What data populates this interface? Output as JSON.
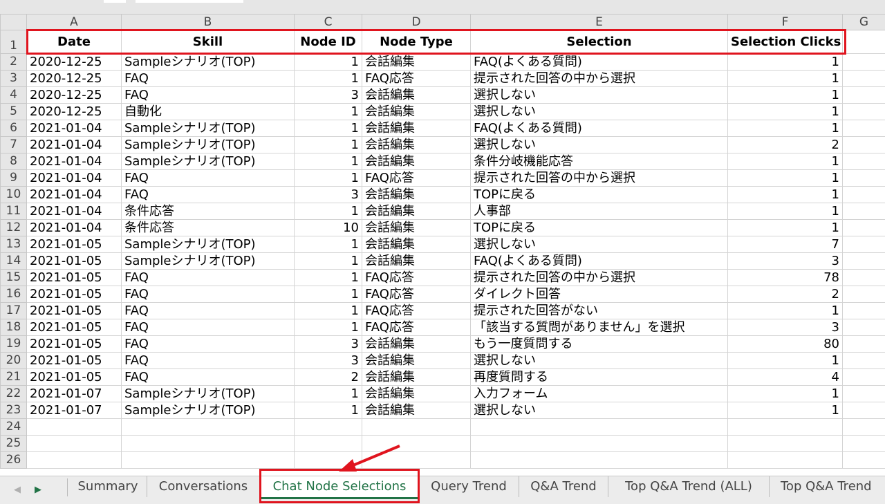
{
  "columns": [
    "A",
    "B",
    "C",
    "D",
    "E",
    "F",
    "G"
  ],
  "header": {
    "date": "Date",
    "skill": "Skill",
    "node_id": "Node ID",
    "node_type": "Node Type",
    "selection": "Selection",
    "selection_clicks": "Selection Clicks"
  },
  "rows": [
    [
      "2020-12-25",
      "Sampleシナリオ(TOP)",
      "1",
      "会話編集",
      "FAQ(よくある質問)",
      "1"
    ],
    [
      "2020-12-25",
      "FAQ",
      "1",
      "FAQ応答",
      "提示された回答の中から選択",
      "1"
    ],
    [
      "2020-12-25",
      "FAQ",
      "3",
      "会話編集",
      "選択しない",
      "1"
    ],
    [
      "2020-12-25",
      "自動化",
      "1",
      "会話編集",
      "選択しない",
      "1"
    ],
    [
      "2021-01-04",
      "Sampleシナリオ(TOP)",
      "1",
      "会話編集",
      "FAQ(よくある質問)",
      "1"
    ],
    [
      "2021-01-04",
      "Sampleシナリオ(TOP)",
      "1",
      "会話編集",
      "選択しない",
      "2"
    ],
    [
      "2021-01-04",
      "Sampleシナリオ(TOP)",
      "1",
      "会話編集",
      "条件分岐機能応答",
      "1"
    ],
    [
      "2021-01-04",
      "FAQ",
      "1",
      "FAQ応答",
      "提示された回答の中から選択",
      "1"
    ],
    [
      "2021-01-04",
      "FAQ",
      "3",
      "会話編集",
      "TOPに戻る",
      "1"
    ],
    [
      "2021-01-04",
      "条件応答",
      "1",
      "会話編集",
      "人事部",
      "1"
    ],
    [
      "2021-01-04",
      "条件応答",
      "10",
      "会話編集",
      "TOPに戻る",
      "1"
    ],
    [
      "2021-01-05",
      "Sampleシナリオ(TOP)",
      "1",
      "会話編集",
      "選択しない",
      "7"
    ],
    [
      "2021-01-05",
      "Sampleシナリオ(TOP)",
      "1",
      "会話編集",
      "FAQ(よくある質問)",
      "3"
    ],
    [
      "2021-01-05",
      "FAQ",
      "1",
      "FAQ応答",
      "提示された回答の中から選択",
      "78"
    ],
    [
      "2021-01-05",
      "FAQ",
      "1",
      "FAQ応答",
      "ダイレクト回答",
      "2"
    ],
    [
      "2021-01-05",
      "FAQ",
      "1",
      "FAQ応答",
      "提示された回答がない",
      "1"
    ],
    [
      "2021-01-05",
      "FAQ",
      "1",
      "FAQ応答",
      "「該当する質問がありません」を選択",
      "3"
    ],
    [
      "2021-01-05",
      "FAQ",
      "3",
      "会話編集",
      "もう一度質問する",
      "80"
    ],
    [
      "2021-01-05",
      "FAQ",
      "3",
      "会話編集",
      "選択しない",
      "1"
    ],
    [
      "2021-01-05",
      "FAQ",
      "2",
      "会話編集",
      "再度質問する",
      "4"
    ],
    [
      "2021-01-07",
      "Sampleシナリオ(TOP)",
      "1",
      "会話編集",
      "入力フォーム",
      "1"
    ],
    [
      "2021-01-07",
      "Sampleシナリオ(TOP)",
      "1",
      "会話編集",
      "選択しない",
      "1"
    ]
  ],
  "row_numbers": [
    "1",
    "2",
    "3",
    "4",
    "5",
    "6",
    "7",
    "8",
    "9",
    "10",
    "11",
    "12",
    "13",
    "14",
    "15",
    "16",
    "17",
    "18",
    "19",
    "20",
    "21",
    "22",
    "23",
    "24",
    "25",
    "26"
  ],
  "tabs": {
    "summary": "Summary",
    "conversations": "Conversations",
    "chat_node_selections": "Chat Node Selections",
    "query_trend": "Query Trend",
    "qa_trend": "Q&A Trend",
    "top_qa_trend_all": "Top Q&A Trend (ALL)",
    "top_qa_trend": "Top Q&A Trend"
  },
  "icons": {
    "prev_sheet": "triangle-left-icon",
    "next_sheet": "triangle-right-icon"
  },
  "colors": {
    "highlight": "#e0141e",
    "active_tab": "#217346"
  }
}
